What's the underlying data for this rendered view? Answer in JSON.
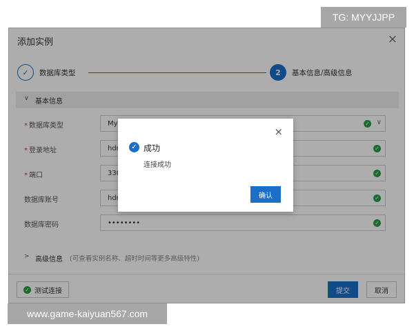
{
  "dialog": {
    "title": "添加实例",
    "close_icon": "×",
    "steps": [
      {
        "icon": "✓",
        "label": "数据库类型"
      },
      {
        "number": "2",
        "label": "基本信息/高级信息"
      }
    ],
    "basic_section": {
      "chevron": "∨",
      "title": "基本信息"
    },
    "fields": [
      {
        "label": "数据库类型",
        "required": true,
        "value": "My",
        "status": "ok",
        "has_dropdown": true
      },
      {
        "label": "登录地址",
        "required": true,
        "value": "hdr",
        "status": "ok"
      },
      {
        "label": "端口",
        "required": true,
        "value": "330",
        "status": "ok"
      },
      {
        "label": "数据库账号",
        "required": false,
        "value": "hdr",
        "status": "ok"
      },
      {
        "label": "数据库密码",
        "required": false,
        "value": "••••••••",
        "status": "ok"
      }
    ],
    "advanced_section": {
      "chevron": ">",
      "title": "高级信息",
      "hint": "(可查看实例名称、超时时间等更多高级特性)"
    },
    "footer": {
      "test_connection_label": "测试连接",
      "submit_label": "提交",
      "cancel_label": "取消"
    }
  },
  "modal": {
    "close_icon": "×",
    "title": "成功",
    "message": "连接成功",
    "confirm_label": "确认"
  },
  "watermarks": {
    "top": "TG: MYYJJPP",
    "bottom": "www.game-kaiyuan567.com"
  },
  "colors": {
    "primary": "#1a6fc9",
    "success": "#26a043",
    "watermark_bg": "#a7a7a7"
  },
  "icons": {
    "check": "✓",
    "dropdown": "∨"
  }
}
